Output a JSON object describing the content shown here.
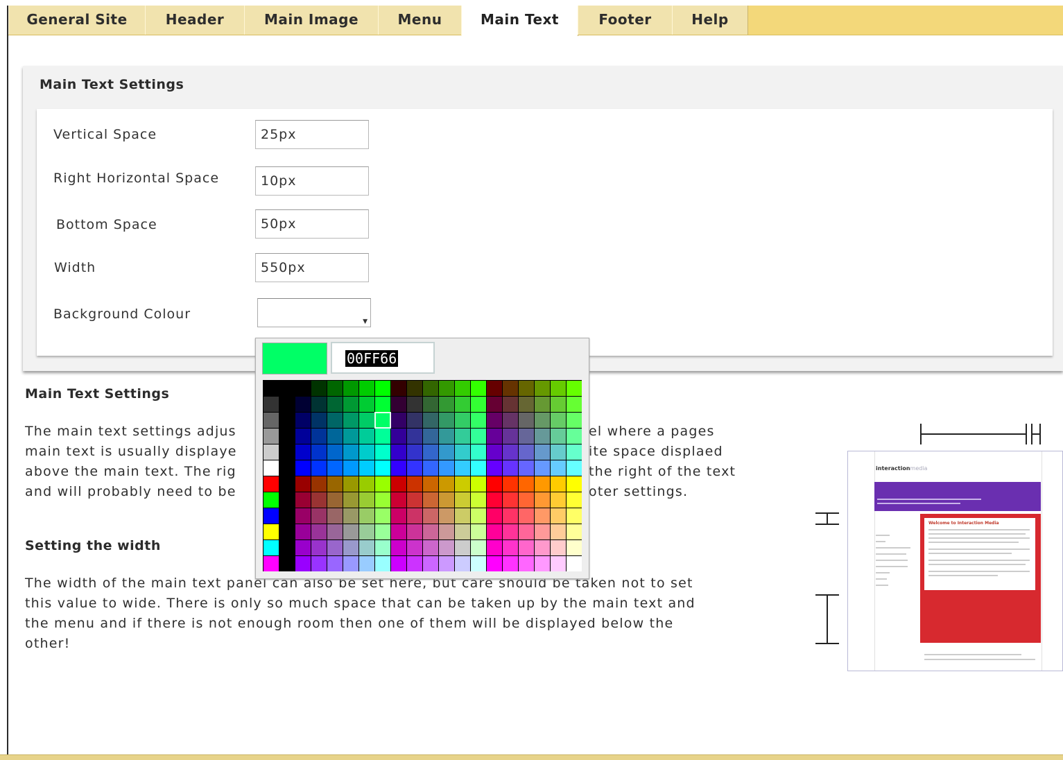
{
  "tabs": [
    {
      "label": "General Site",
      "active": false
    },
    {
      "label": "Header",
      "active": false
    },
    {
      "label": "Main Image",
      "active": false
    },
    {
      "label": "Menu",
      "active": false
    },
    {
      "label": "Main Text",
      "active": true
    },
    {
      "label": "Footer",
      "active": false
    },
    {
      "label": "Help",
      "active": false
    }
  ],
  "settings": {
    "title": "Main Text Settings",
    "rows": [
      {
        "label": "Vertical Space",
        "value": "25px"
      },
      {
        "label": "Right Horizontal Space",
        "value": "10px"
      },
      {
        "label": "Bottom Space",
        "value": "50px"
      },
      {
        "label": "Width",
        "value": "550px"
      },
      {
        "label": "Background Colour",
        "value": ""
      }
    ]
  },
  "color_picker": {
    "hex_value": "00FF66",
    "preview_color": "#00ff66",
    "selected_color": "#00ff66"
  },
  "help": {
    "heading1": "Main Text Settings",
    "para1_lines": [
      "The main text settings adjus",
      "main text is usually displaye",
      "above the main text. The rig",
      "and will probably need to be"
    ],
    "para1_right_lines": [
      "el where a pages",
      "ite space displaed",
      "the right of the text",
      "oter settings."
    ],
    "heading2": "Setting the width",
    "para2_lines": [
      "The width of the main text panel can also be set here, but care should be taken not to set",
      "this value to wide. There is only so much space that can be taken up by the main text and",
      "the menu and if there is not enough room then one of them will be displayed below the",
      "other!"
    ]
  },
  "diagram": {
    "logo_text": "interaction",
    "logo_text_light": "media",
    "banner_color": "#6a2fb0",
    "content_color": "#d7292f",
    "content_title": "Welcome to Interaction Media"
  }
}
